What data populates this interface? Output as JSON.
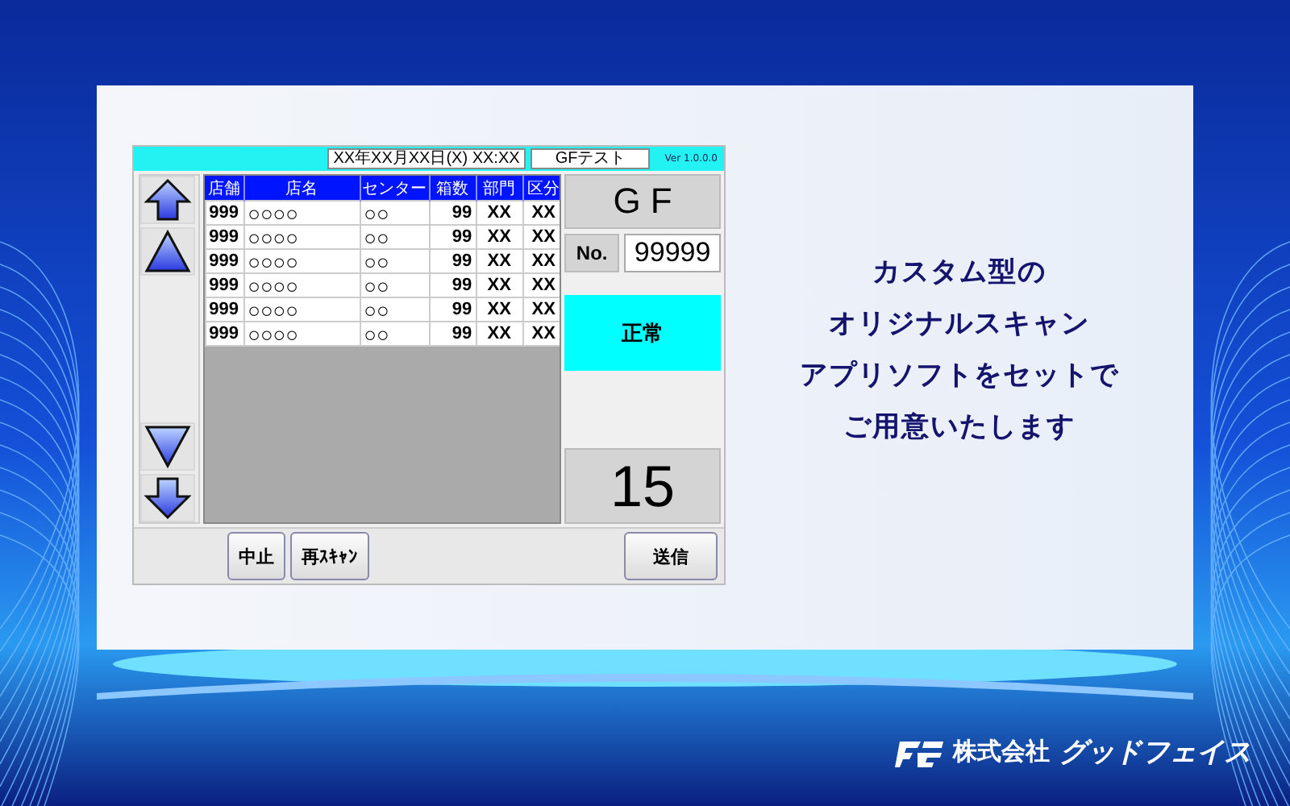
{
  "app": {
    "date": "XX年XX月XX日(X) XX:XX",
    "title": "GFテスト",
    "version": "Ver 1.0.0.0",
    "table": {
      "columns": [
        "店舗",
        "店名",
        "センター",
        "箱数",
        "部門",
        "区分"
      ],
      "rows": [
        [
          "999",
          "○○○○",
          "○○",
          "99",
          "XX",
          "XX"
        ],
        [
          "999",
          "○○○○",
          "○○",
          "99",
          "XX",
          "XX"
        ],
        [
          "999",
          "○○○○",
          "○○",
          "99",
          "XX",
          "XX"
        ],
        [
          "999",
          "○○○○",
          "○○",
          "99",
          "XX",
          "XX"
        ],
        [
          "999",
          "○○○○",
          "○○",
          "99",
          "XX",
          "XX"
        ],
        [
          "999",
          "○○○○",
          "○○",
          "99",
          "XX",
          "XX"
        ]
      ]
    },
    "company_code": "G F",
    "no_label": "No.",
    "number": "99999",
    "status": "正常",
    "count": "15",
    "buttons": [
      "中止",
      "再ｽｷｬﾝ",
      "送信"
    ]
  },
  "headline": [
    "カスタム型の",
    "オリジナルスキャン",
    "アプリソフトをセットで",
    "ご用意いたします"
  ],
  "company": "株式会社",
  "company_name": "グッドフェイス"
}
